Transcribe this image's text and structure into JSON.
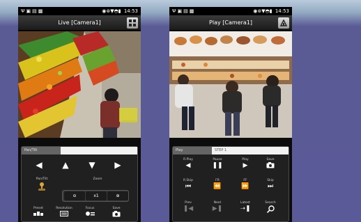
{
  "status_bar": {
    "time": "14:53"
  },
  "live": {
    "title": "Live [Camera1]",
    "tab_label": "Pan/Tilt",
    "controls": {
      "pan_tilt_label": "Pan/Tilt",
      "zoom_label": "Zoom",
      "zoom_value": "x1",
      "preset_label": "Preset",
      "resolution_label": "Resolution",
      "focus_label": "Focus",
      "save_label": "Save"
    }
  },
  "play": {
    "title": "Play [Camera1]",
    "tab_active": "Play",
    "tab_inactive": "STEP 1",
    "controls": {
      "rplay_label": "R.Play",
      "pause_label": "Pause",
      "play_label": "Play",
      "save_label": "Save",
      "rskip_label": "R.Skip",
      "fr_label": "FR",
      "ff_label": "FF",
      "skip_label": "Skip",
      "prev_label": "Prev",
      "next_label": "Next",
      "latest_label": "Latest",
      "search_label": "Search"
    }
  },
  "colors": {
    "background_purple": "#5b5a99",
    "phone_body": "#0c0c0c",
    "panel_bg": "#202020"
  }
}
